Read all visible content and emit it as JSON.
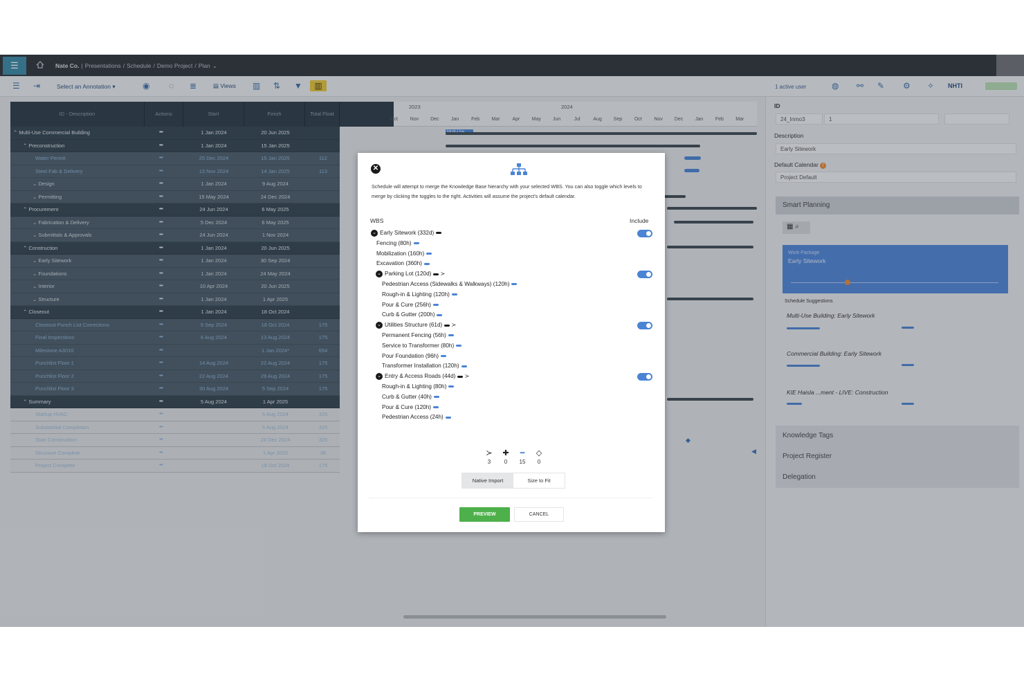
{
  "topbar": {
    "menu_icon": "menu-icon",
    "breadcrumb": [
      "Nate Co.",
      "|",
      "Presentations",
      "/",
      "Schedule",
      "/",
      "Demo Project",
      "/",
      "Plan"
    ],
    "accent_color": "#3b8aa6"
  },
  "toolbar": {
    "annotation_select": "Select an Annotation ▾",
    "views_label": "Views",
    "active_users": "1 active user",
    "user_initials": "NHTI"
  },
  "grid": {
    "columns": [
      "ID - Description",
      "Actions",
      "Start",
      "Finish",
      "Total Float"
    ],
    "rows": [
      {
        "name": "Multi-Use Commercial Building",
        "level": 0,
        "style": "dark",
        "caret": "^",
        "actions": "•••",
        "start": "1 Jan 2024",
        "finish": "20 Jun 2025",
        "float": ""
      },
      {
        "name": "Preconstruction",
        "level": 1,
        "style": "dark",
        "caret": "^",
        "actions": "•••",
        "start": "1 Jan 2024",
        "finish": "15 Jan 2025",
        "float": ""
      },
      {
        "name": "Water Permit",
        "level": 3,
        "style": "light",
        "caret": "",
        "actions": "•••",
        "start": "25 Dec 2024",
        "finish": "15 Jan 2025",
        "float": "112"
      },
      {
        "name": "Steel Fab & Delivery",
        "level": 3,
        "style": "light",
        "caret": "",
        "actions": "•••",
        "start": "13 Nov 2024",
        "finish": "14 Jan 2025",
        "float": "113"
      },
      {
        "name": "Design",
        "level": 2,
        "style": "mid",
        "caret": "v",
        "actions": "•••",
        "start": "1 Jan 2024",
        "finish": "9 Aug 2024",
        "float": ""
      },
      {
        "name": "Permitting",
        "level": 2,
        "style": "mid",
        "caret": "v",
        "actions": "•••",
        "start": "15 May 2024",
        "finish": "24 Dec 2024",
        "float": ""
      },
      {
        "name": "Procurement",
        "level": 1,
        "style": "dark",
        "caret": "^",
        "actions": "•••",
        "start": "24 Jun 2024",
        "finish": "6 May 2025",
        "float": ""
      },
      {
        "name": "Fabrication & Delivery",
        "level": 2,
        "style": "mid",
        "caret": "v",
        "actions": "•••",
        "start": "5 Dec 2024",
        "finish": "6 May 2025",
        "float": ""
      },
      {
        "name": "Submittals & Approvals",
        "level": 2,
        "style": "mid",
        "caret": "v",
        "actions": "•••",
        "start": "24 Jun 2024",
        "finish": "1 Nov 2024",
        "float": ""
      },
      {
        "name": "Construction",
        "level": 1,
        "style": "dark",
        "caret": "^",
        "actions": "•••",
        "start": "1 Jan 2024",
        "finish": "20 Jun 2025",
        "float": ""
      },
      {
        "name": "Early Sitework",
        "level": 2,
        "style": "mid",
        "caret": "v",
        "actions": "•••",
        "start": "1 Jan 2024",
        "finish": "30 Sep 2024",
        "float": ""
      },
      {
        "name": "Foundations",
        "level": 2,
        "style": "mid",
        "caret": "v",
        "actions": "•••",
        "start": "1 Jan 2024",
        "finish": "24 May 2024",
        "float": ""
      },
      {
        "name": "Interior",
        "level": 2,
        "style": "mid",
        "caret": "v",
        "actions": "•••",
        "start": "10 Apr 2024",
        "finish": "20 Jun 2025",
        "float": ""
      },
      {
        "name": "Structure",
        "level": 2,
        "style": "mid",
        "caret": "v",
        "actions": "•••",
        "start": "1 Jan 2024",
        "finish": "1 Apr 2025",
        "float": ""
      },
      {
        "name": "Closeout",
        "level": 1,
        "style": "dark",
        "caret": "^",
        "actions": "•••",
        "start": "1 Jan 2024",
        "finish": "18 Oct 2024",
        "float": ""
      },
      {
        "name": "Closeout Punch List Corrections",
        "level": 3,
        "style": "light",
        "caret": "",
        "actions": "•••",
        "start": "9 Sep 2024",
        "finish": "18 Oct 2024",
        "float": "175"
      },
      {
        "name": "Final Inspections",
        "level": 3,
        "style": "light",
        "caret": "",
        "actions": "•••",
        "start": "6 Aug 2024",
        "finish": "13 Aug 2024",
        "float": "175"
      },
      {
        "name": "Milestone A3010",
        "level": 3,
        "style": "light",
        "caret": "",
        "actions": "•••",
        "start": "",
        "finish": "1 Jan 2024*",
        "float": "654"
      },
      {
        "name": "Punchlist Floor 1",
        "level": 3,
        "style": "light",
        "caret": "",
        "actions": "•••",
        "start": "14 Aug 2024",
        "finish": "22 Aug 2024",
        "float": "175"
      },
      {
        "name": "Punchlist Floor 2",
        "level": 3,
        "style": "light",
        "caret": "",
        "actions": "•••",
        "start": "22 Aug 2024",
        "finish": "29 Aug 2024",
        "float": "175"
      },
      {
        "name": "Punchlist Floor 3",
        "level": 3,
        "style": "light",
        "caret": "",
        "actions": "•••",
        "start": "30 Aug 2024",
        "finish": "5 Sep 2024",
        "float": "175"
      },
      {
        "name": "Summary",
        "level": 1,
        "style": "dark",
        "caret": "^",
        "actions": "•••",
        "start": "5 Aug 2024",
        "finish": "1 Apr 2025",
        "float": ""
      },
      {
        "name": "Startup HVAC",
        "level": 3,
        "style": "pale",
        "caret": "",
        "actions": "•••",
        "start": "",
        "finish": "5 Aug 2024",
        "float": "325"
      },
      {
        "name": "Substantial Completion",
        "level": 3,
        "style": "pale",
        "caret": "",
        "actions": "•••",
        "start": "",
        "finish": "5 Aug 2024",
        "float": "325"
      },
      {
        "name": "Start Construction",
        "level": 3,
        "style": "pale",
        "caret": "",
        "actions": "•••",
        "start": "",
        "finish": "24 Dec 2024",
        "float": "325"
      },
      {
        "name": "Structure Complete",
        "level": 3,
        "style": "pale",
        "caret": "",
        "actions": "•••",
        "start": "",
        "finish": "1 Apr 2025",
        "float": "36"
      },
      {
        "name": "Project Complete",
        "level": 3,
        "style": "pale",
        "caret": "",
        "actions": "•••",
        "start": "",
        "finish": "18 Oct 2024",
        "float": "175"
      }
    ]
  },
  "timeline": {
    "years": [
      "2023",
      "2024"
    ],
    "months": [
      "Oct",
      "Nov",
      "Dec",
      "Jan",
      "Feb",
      "Mar",
      "Apr",
      "May",
      "Jun",
      "Jul",
      "Aug",
      "Sep",
      "Oct",
      "Nov",
      "Dec",
      "Jan",
      "Feb",
      "Mar"
    ],
    "top_bar_label": "Multi-Use"
  },
  "panel": {
    "id_label": "ID",
    "id_value": "24_Inmo3",
    "id_extra": "1",
    "description_label": "Description",
    "description_value": "Early Sitework",
    "calendar_label": "Default Calendar",
    "calendar_value": "Project Default",
    "smart_planning": "Smart Planning",
    "work_package_label": "Work Package",
    "work_package_value": "Early Sitework",
    "suggestions_label": "Schedule Suggestions",
    "suggestions": [
      "Multi-Use Building: Early Sitework",
      "Commercial Building: Early Sitework",
      "KIE Haisla ...ment - LIVE: Construction"
    ],
    "sections": [
      "Knowledge Tags",
      "Project Register",
      "Delegation"
    ]
  },
  "modal": {
    "description": "Schedule will attempt to merge the Knowledge Base hierarchy with your selected WBS. You can also toggle which levels to merge by clicking the toggles to the right. Activities will assume the project's default calendar.",
    "wbs_label": "WBS",
    "include_label": "Include",
    "groups": [
      {
        "title": "Early Sitework (332d)",
        "items": [
          "Fencing (80h)",
          "Mobilization (160h)",
          "Excavation (360h)"
        ]
      },
      {
        "title": "Parking Lot (120d)",
        "items": [
          "Pedestrian Access (Sidewalks & Walkways) (120h)",
          "Rough-in & Lighting (120h)",
          "Pour & Cure (256h)",
          "Curb & Gutter (200h)"
        ]
      },
      {
        "title": "Utilities Structure (61d)",
        "items": [
          "Permanent Fencing (56h)",
          "Service to Transformer (80h)",
          "Pour Foundation (96h)",
          "Transformer Installation (120h)"
        ]
      },
      {
        "title": "Entry & Access Roads (44d)",
        "items": [
          "Rough-in & Lighting (80h)",
          "Curb & Gutter (40h)",
          "Pour & Cure (120h)",
          "Pedestrian Access (24h)"
        ]
      }
    ],
    "stats": [
      {
        "glyph": "≻",
        "value": "3"
      },
      {
        "glyph": "✚",
        "value": "0"
      },
      {
        "glyph": "━",
        "value": "15"
      },
      {
        "glyph": "◇",
        "value": "0"
      }
    ],
    "tab_native": "Native Import",
    "tab_size": "Size to Fit",
    "preview_label": "PREVIEW",
    "cancel_label": "CANCEL",
    "toggle_color": "#4a84d3",
    "preview_color": "#4db04a"
  }
}
